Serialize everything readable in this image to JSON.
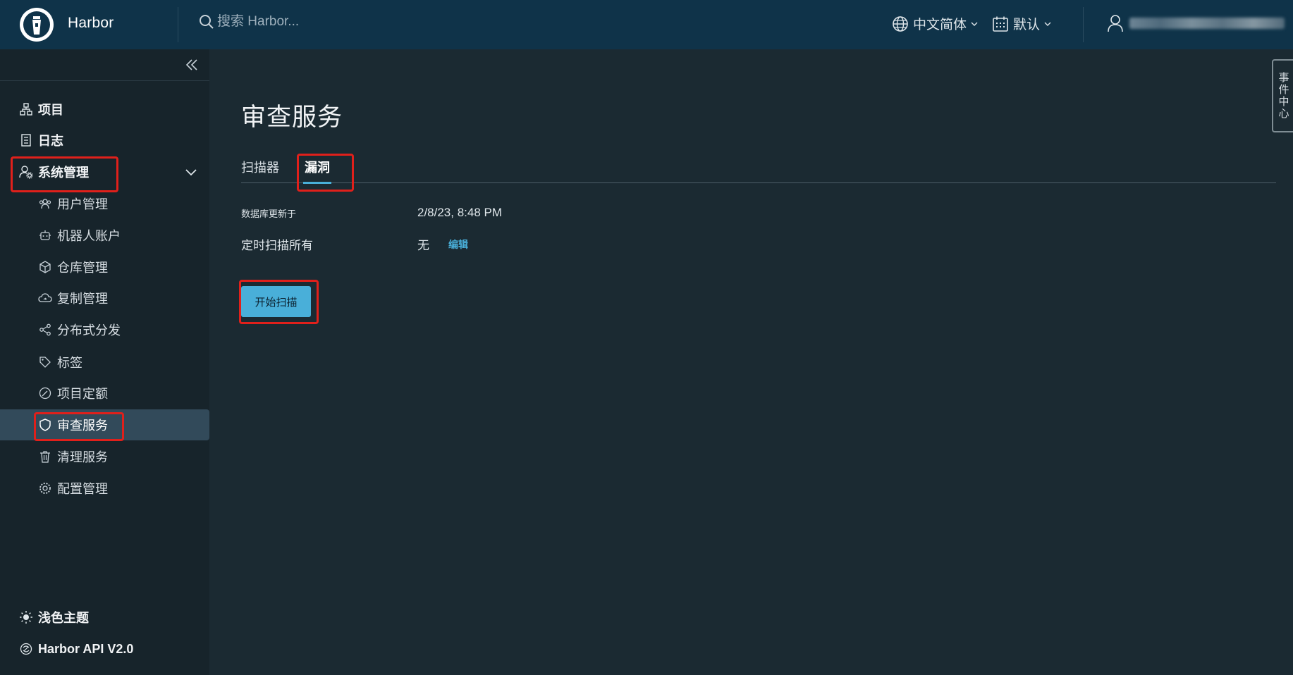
{
  "header": {
    "brand": "Harbor",
    "search_placeholder": "搜索 Harbor...",
    "language": "中文简体",
    "datetime_format": "默认"
  },
  "sidebar": {
    "top_items": [
      {
        "label": "项目",
        "icon": "projects-icon"
      },
      {
        "label": "日志",
        "icon": "logs-icon"
      },
      {
        "label": "系统管理",
        "icon": "user-cog-icon"
      }
    ],
    "admin_items": [
      {
        "label": "用户管理",
        "icon": "users-icon"
      },
      {
        "label": "机器人账户",
        "icon": "robot-icon"
      },
      {
        "label": "仓库管理",
        "icon": "box-icon"
      },
      {
        "label": "复制管理",
        "icon": "cloud-sync-icon"
      },
      {
        "label": "分布式分发",
        "icon": "share-icon"
      },
      {
        "label": "标签",
        "icon": "tag-icon"
      },
      {
        "label": "项目定额",
        "icon": "quota-icon"
      },
      {
        "label": "审查服务",
        "icon": "shield-icon"
      },
      {
        "label": "清理服务",
        "icon": "trash-icon"
      },
      {
        "label": "配置管理",
        "icon": "gear-icon"
      }
    ],
    "bottom_items": [
      {
        "label": "浅色主题",
        "icon": "sun-icon"
      },
      {
        "label": "Harbor API V2.0",
        "icon": "api-icon"
      }
    ]
  },
  "main": {
    "title": "审查服务",
    "tabs": [
      {
        "label": "扫描器"
      },
      {
        "label": "漏洞",
        "active": true
      }
    ],
    "db_updated_label": "数据库更新于",
    "db_updated_value": "2/8/23, 8:48 PM",
    "schedule_label": "定时扫描所有",
    "schedule_value": "无",
    "edit_label": "编辑",
    "scan_button": "开始扫描"
  },
  "event_tab": "事件中心",
  "colors": {
    "header_bg": "#0f3349",
    "sidebar_bg": "#17242b",
    "main_bg": "#1b2a32",
    "accent": "#49afd9",
    "highlight_box": "#e0201b"
  }
}
